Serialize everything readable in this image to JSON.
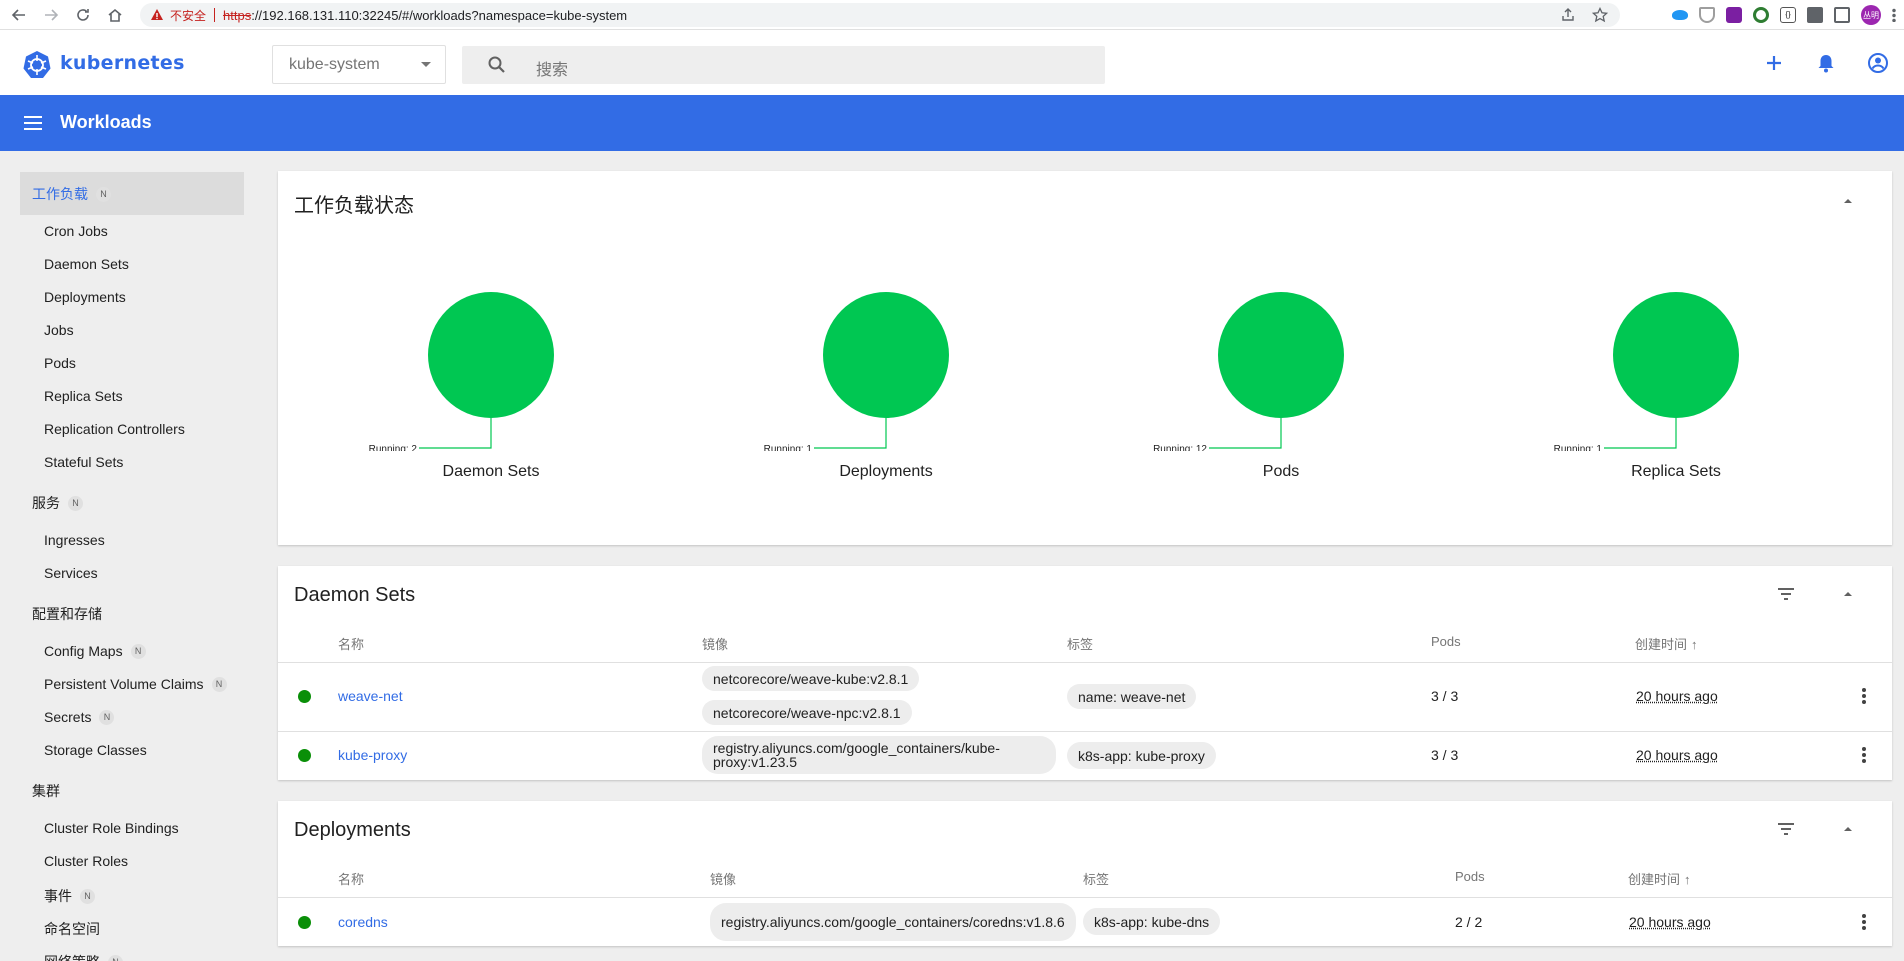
{
  "browser": {
    "not_secure": "不安全",
    "url_scheme": "https",
    "url_rest": "://192.168.131.110:32245/#/workloads?namespace=kube-system",
    "profile": "丛明"
  },
  "header": {
    "brand": "kubernetes",
    "namespace": "kube-system",
    "search_placeholder": "搜索"
  },
  "toolbar": {
    "title": "Workloads"
  },
  "sidebar": {
    "workloads_head": "工作负载",
    "workloads_items": [
      "Cron Jobs",
      "Daemon Sets",
      "Deployments",
      "Jobs",
      "Pods",
      "Replica Sets",
      "Replication Controllers",
      "Stateful Sets"
    ],
    "service_head": "服务",
    "service_items": [
      "Ingresses",
      "Services"
    ],
    "config_head": "配置和存储",
    "config_items": [
      "Config Maps",
      "Persistent Volume Claims",
      "Secrets",
      "Storage Classes"
    ],
    "cluster_head": "集群",
    "cluster_items": [
      "Cluster Role Bindings",
      "Cluster Roles",
      "事件",
      "命名空间",
      "网络策略"
    ],
    "badge": "N"
  },
  "status_card": {
    "title": "工作负载状态",
    "charts": [
      {
        "label": "Daemon Sets",
        "running_text": "Running: 2",
        "running": 2
      },
      {
        "label": "Deployments",
        "running_text": "Running: 1",
        "running": 1
      },
      {
        "label": "Pods",
        "running_text": "Running: 12",
        "running": 12
      },
      {
        "label": "Replica Sets",
        "running_text": "Running: 1",
        "running": 1
      }
    ],
    "color": "#00c752"
  },
  "columns": {
    "name": "名称",
    "image": "镜像",
    "labels": "标签",
    "pods": "Pods",
    "created": "创建时间",
    "sort_arrow": "↑"
  },
  "daemonsets": {
    "title": "Daemon Sets",
    "rows": [
      {
        "name": "weave-net",
        "images": [
          "netcorecore/weave-kube:v2.8.1",
          "netcorecore/weave-npc:v2.8.1"
        ],
        "label": "name: weave-net",
        "pods": "3 / 3",
        "created": "20 hours ago"
      },
      {
        "name": "kube-proxy",
        "images": [
          "registry.aliyuncs.com/google_containers/kube-proxy:v1.23.5"
        ],
        "label": "k8s-app: kube-proxy",
        "pods": "3 / 3",
        "created": "20 hours ago"
      }
    ]
  },
  "deployments": {
    "title": "Deployments",
    "rows": [
      {
        "name": "coredns",
        "images": [
          "registry.aliyuncs.com/google_containers/coredns:v1.8.6"
        ],
        "label": "k8s-app: kube-dns",
        "pods": "2 / 2",
        "created": "20 hours ago"
      }
    ]
  }
}
